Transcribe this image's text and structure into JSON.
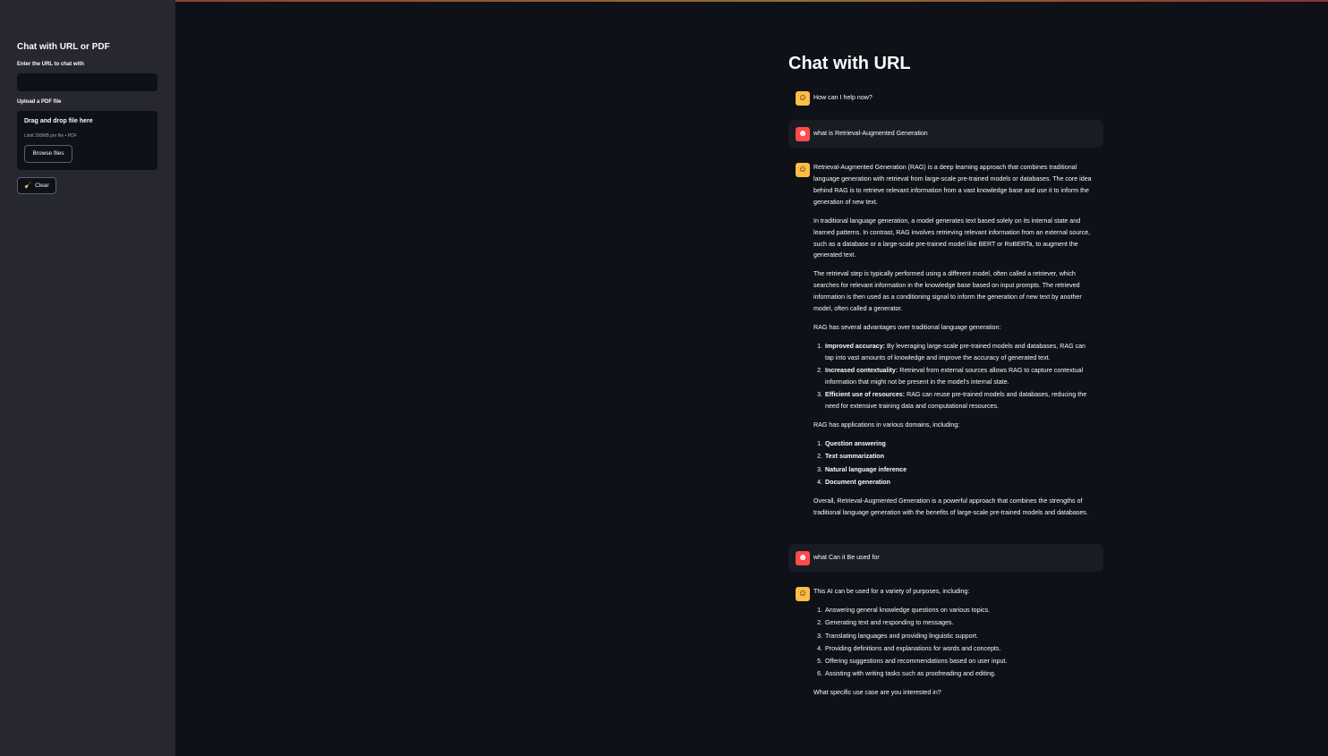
{
  "sidebar": {
    "title": "Chat with URL or PDF",
    "url_label": "Enter the URL to chat with",
    "url_value": "",
    "pdf_label": "Upload a PDF file",
    "dropzone_title": "Drag and drop file here",
    "dropzone_limit": "Limit 200MB per file • PDF",
    "browse_label": "Browse files",
    "clear_label": "Clear",
    "clear_icon": "🧹"
  },
  "main": {
    "title": "Chat with URL",
    "messages": [
      {
        "role": "assistant",
        "avatar": "robot-icon",
        "text": "How can I help now?"
      },
      {
        "role": "user",
        "avatar": "user-icon",
        "text": "what is Retrieval-Augmented Generation"
      },
      {
        "role": "assistant",
        "avatar": "robot-icon",
        "paragraphs": [
          "Retrieval-Augmented Generation (RAG) is a deep learning approach that combines traditional language generation with retrieval from large-scale pre-trained models or databases. The core idea behind RAG is to retrieve relevant information from a vast knowledge base and use it to inform the generation of new text.",
          "In traditional language generation, a model generates text based solely on its internal state and learned patterns. In contrast, RAG involves retrieving relevant information from an external source, such as a database or a large-scale pre-trained model like BERT or RoBERTa, to augment the generated text.",
          "The retrieval step is typically performed using a different model, often called a retriever, which searches for relevant information in the knowledge base based on input prompts. The retrieved information is then used as a conditioning signal to inform the generation of new text by another model, often called a generator.",
          "RAG has several advantages over traditional language generation:"
        ],
        "advantages": [
          {
            "bold": "Improved accuracy:",
            "text": " By leveraging large-scale pre-trained models and databases, RAG can tap into vast amounts of knowledge and improve the accuracy of generated text."
          },
          {
            "bold": "Increased contextuality:",
            "text": " Retrieval from external sources allows RAG to capture contextual information that might not be present in the model's internal state."
          },
          {
            "bold": "Efficient use of resources:",
            "text": " RAG can reuse pre-trained models and databases, reducing the need for extensive training data and computational resources."
          }
        ],
        "applications_intro": "RAG has applications in various domains, including:",
        "applications": [
          "Question answering",
          "Text summarization",
          "Natural language inference",
          "Document generation"
        ],
        "conclusion": "Overall, Retrieval-Augmented Generation is a powerful approach that combines the strengths of traditional language generation with the benefits of large-scale pre-trained models and databases."
      },
      {
        "role": "user",
        "avatar": "user-icon",
        "text": "what Can it Be used for"
      },
      {
        "role": "assistant",
        "avatar": "robot-icon",
        "intro": "This AI can be used for a variety of purposes, including:",
        "uses": [
          "Answering general knowledge questions on various topics.",
          "Generating text and responding to messages.",
          "Translating languages and providing linguistic support.",
          "Providing definitions and explanations for words and concepts.",
          "Offering suggestions and recommendations based on user input.",
          "Assisting with writing tasks such as proofreading and editing."
        ],
        "outro": "What specific use case are you interested in?"
      }
    ]
  },
  "colors": {
    "background": "#0e1117",
    "sidebar": "#262730",
    "assistant_avatar": "#ffbd45",
    "user_avatar": "#ff4b4b"
  }
}
